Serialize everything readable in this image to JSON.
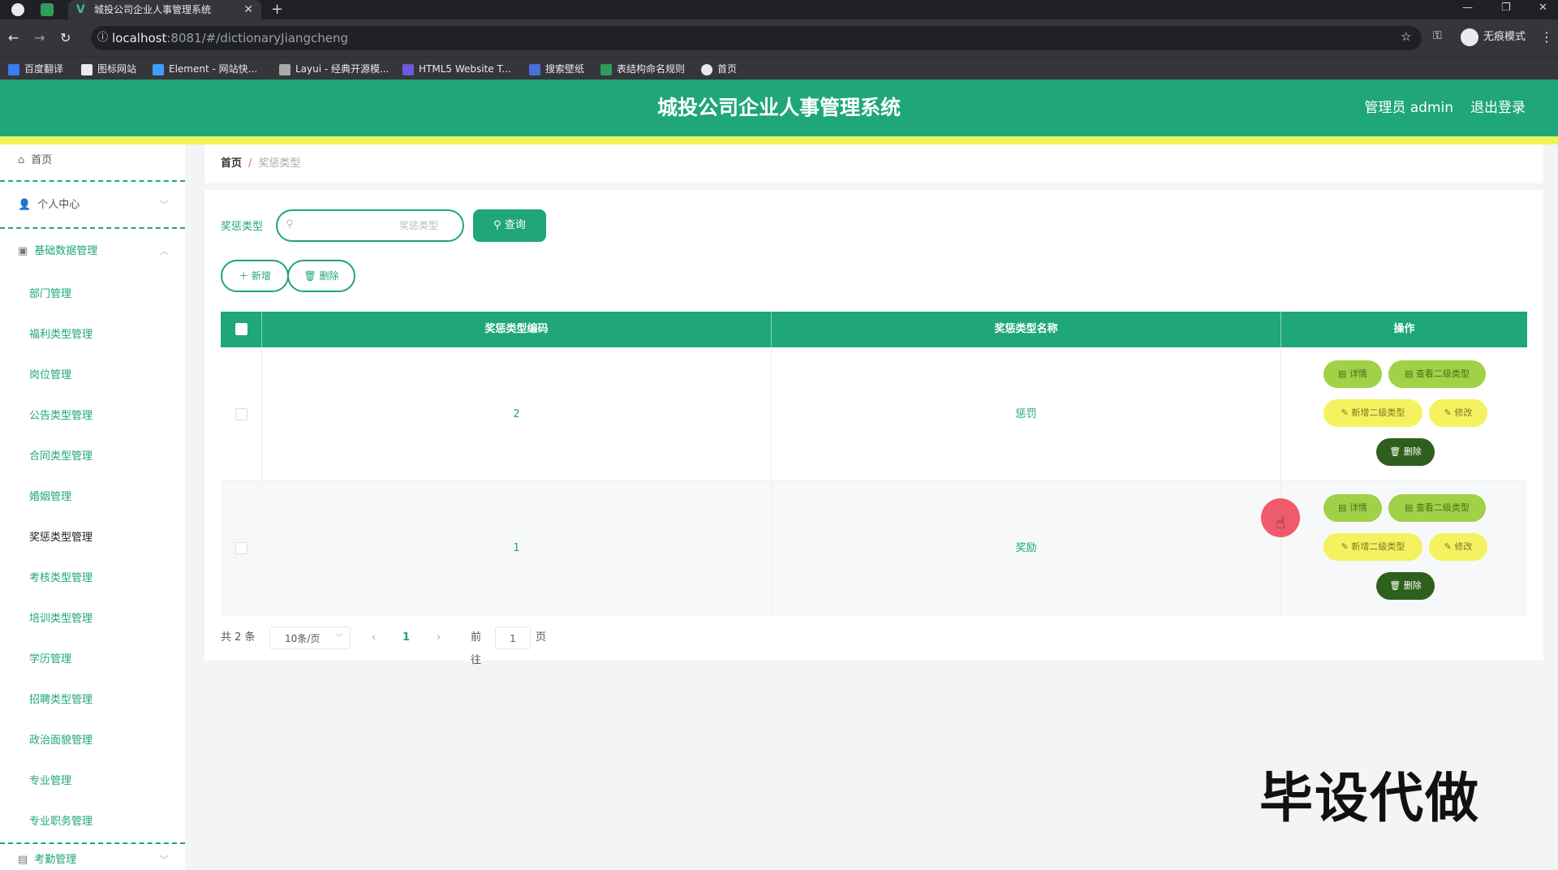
{
  "browser": {
    "tab_title": "城投公司企业人事管理系统",
    "tab_close": "✕",
    "new_tab": "+",
    "url_host": "localhost",
    "url_rest": ":8081/#/dictionaryJiangcheng",
    "incognito": "无痕模式",
    "bookmarks": [
      "百度翻译",
      "图标网站",
      "Element - 网站快...",
      "Layui - 经典开源模...",
      "HTML5 Website T...",
      "搜索壁纸",
      "表结构命名规则",
      "首页"
    ]
  },
  "header": {
    "title": "城投公司企业人事管理系统",
    "admin": "管理员 admin",
    "logout": "退出登录"
  },
  "sidebar": {
    "home": "首页",
    "personal": "个人中心",
    "base_group": "基础数据管理",
    "items": [
      "部门管理",
      "福利类型管理",
      "岗位管理",
      "公告类型管理",
      "合同类型管理",
      "婚姻管理",
      "奖惩类型管理",
      "考核类型管理",
      "培训类型管理",
      "学历管理",
      "招聘类型管理",
      "政治面貌管理",
      "专业管理",
      "专业职务管理"
    ],
    "active_index": 6,
    "bottom_group": "考勤管理"
  },
  "breadcrumb": {
    "home": "首页",
    "sep": "/",
    "current": "奖惩类型"
  },
  "search": {
    "label": "奖惩类型",
    "placeholder": "奖惩类型",
    "button": "查询"
  },
  "actions": {
    "add": "新增",
    "delete": "删除"
  },
  "table": {
    "columns": [
      "奖惩类型编码",
      "奖惩类型名称",
      "操作"
    ],
    "rows": [
      {
        "code": "2",
        "name": "惩罚"
      },
      {
        "code": "1",
        "name": "奖励"
      }
    ],
    "ops": {
      "detail": "详情",
      "view_sub": "查看二级类型",
      "add_sub": "新增二级类型",
      "edit": "修改",
      "delete": "删除"
    }
  },
  "pagination": {
    "total": "共 2 条",
    "page_size": "10条/页",
    "current": "1",
    "goto": "前往",
    "goto_value": "1",
    "page_unit": "页"
  },
  "watermark": "毕设代做",
  "colors": {
    "primary": "#1fa67a",
    "stripe": "#f0f25a",
    "op_green": "#9fd246",
    "op_yellow": "#f4f25e",
    "op_dark": "#2f5f1d"
  }
}
